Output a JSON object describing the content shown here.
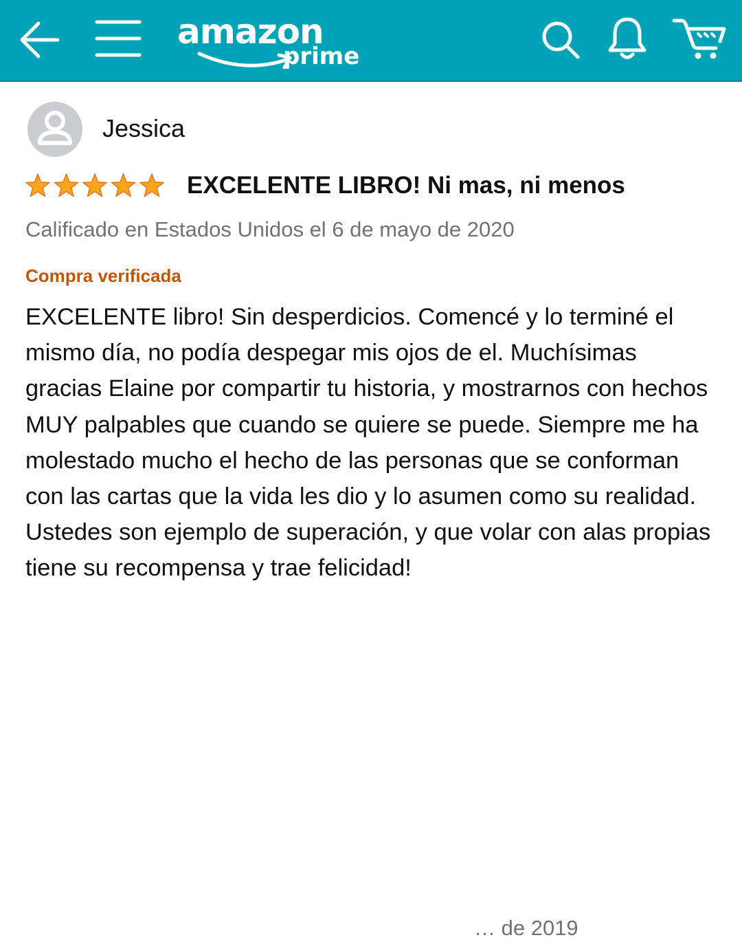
{
  "header": {
    "brand": "amazon",
    "brand_sub": "prime",
    "background_color": "#00a3b5",
    "icons": [
      "back-arrow-icon",
      "hamburger-menu-icon",
      "search-icon",
      "bell-icon",
      "cart-icon"
    ]
  },
  "review": {
    "reviewer_name": "Jessica",
    "rating": 5,
    "rating_max": 5,
    "title": "EXCELENTE LIBRO! Ni mas, ni menos",
    "date_text": "Calificado en Estados Unidos el 6 de mayo de 2020",
    "verified_label": "Compra verificada",
    "body": "EXCELENTE libro! Sin desperdicios. Comencé y lo terminé el mismo día, no podía despegar mis ojos de el. Muchísimas gracias Elaine por compartir tu historia, y mostrarnos con hechos MUY palpables que cuando se quiere se puede. Siempre me ha molestado mucho el hecho de las personas que se conforman con las cartas que la vida les dio y lo asumen como su realidad. Ustedes son ejemplo de superación, y que volar con alas propias tiene su recompensa y trae felicidad!",
    "star_color": "#ffa41c",
    "verified_color": "#c45500"
  },
  "next_review_partial": "… de 2019"
}
